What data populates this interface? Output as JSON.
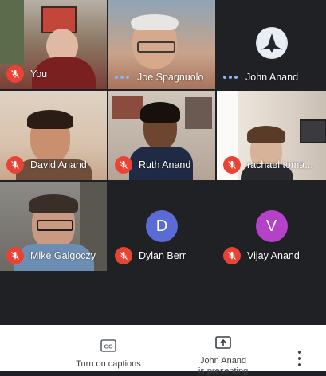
{
  "participants": [
    {
      "name": "You",
      "muted": true
    },
    {
      "name": "Joe Spagnuolo",
      "muted": false,
      "speaking": true
    },
    {
      "name": "John Anand",
      "muted": false,
      "speaking": true,
      "avatar": "jet-icon"
    },
    {
      "name": "David Anand",
      "muted": true
    },
    {
      "name": "Ruth Anand",
      "muted": true
    },
    {
      "name": "rachael toma...",
      "muted": true
    },
    {
      "name": "Mike Galgoczy",
      "muted": true
    },
    {
      "name": "Dylan Berr",
      "muted": true,
      "initial": "D",
      "color": "#5b6bd6"
    },
    {
      "name": "Vijay Anand",
      "muted": true,
      "initial": "V",
      "color": "#b641c9"
    }
  ],
  "toolbar": {
    "captions_label": "Turn on captions",
    "present_label": "John Anand",
    "present_sub": "is presenting",
    "captions_icon": "cc-icon",
    "present_icon": "present-screen-icon",
    "more_icon": "more-vert-icon"
  },
  "colors": {
    "mute_red": "#ea4335",
    "speaking_blue": "#8ab4f8",
    "tile_bg": "#3c4043",
    "background": "#202124"
  }
}
